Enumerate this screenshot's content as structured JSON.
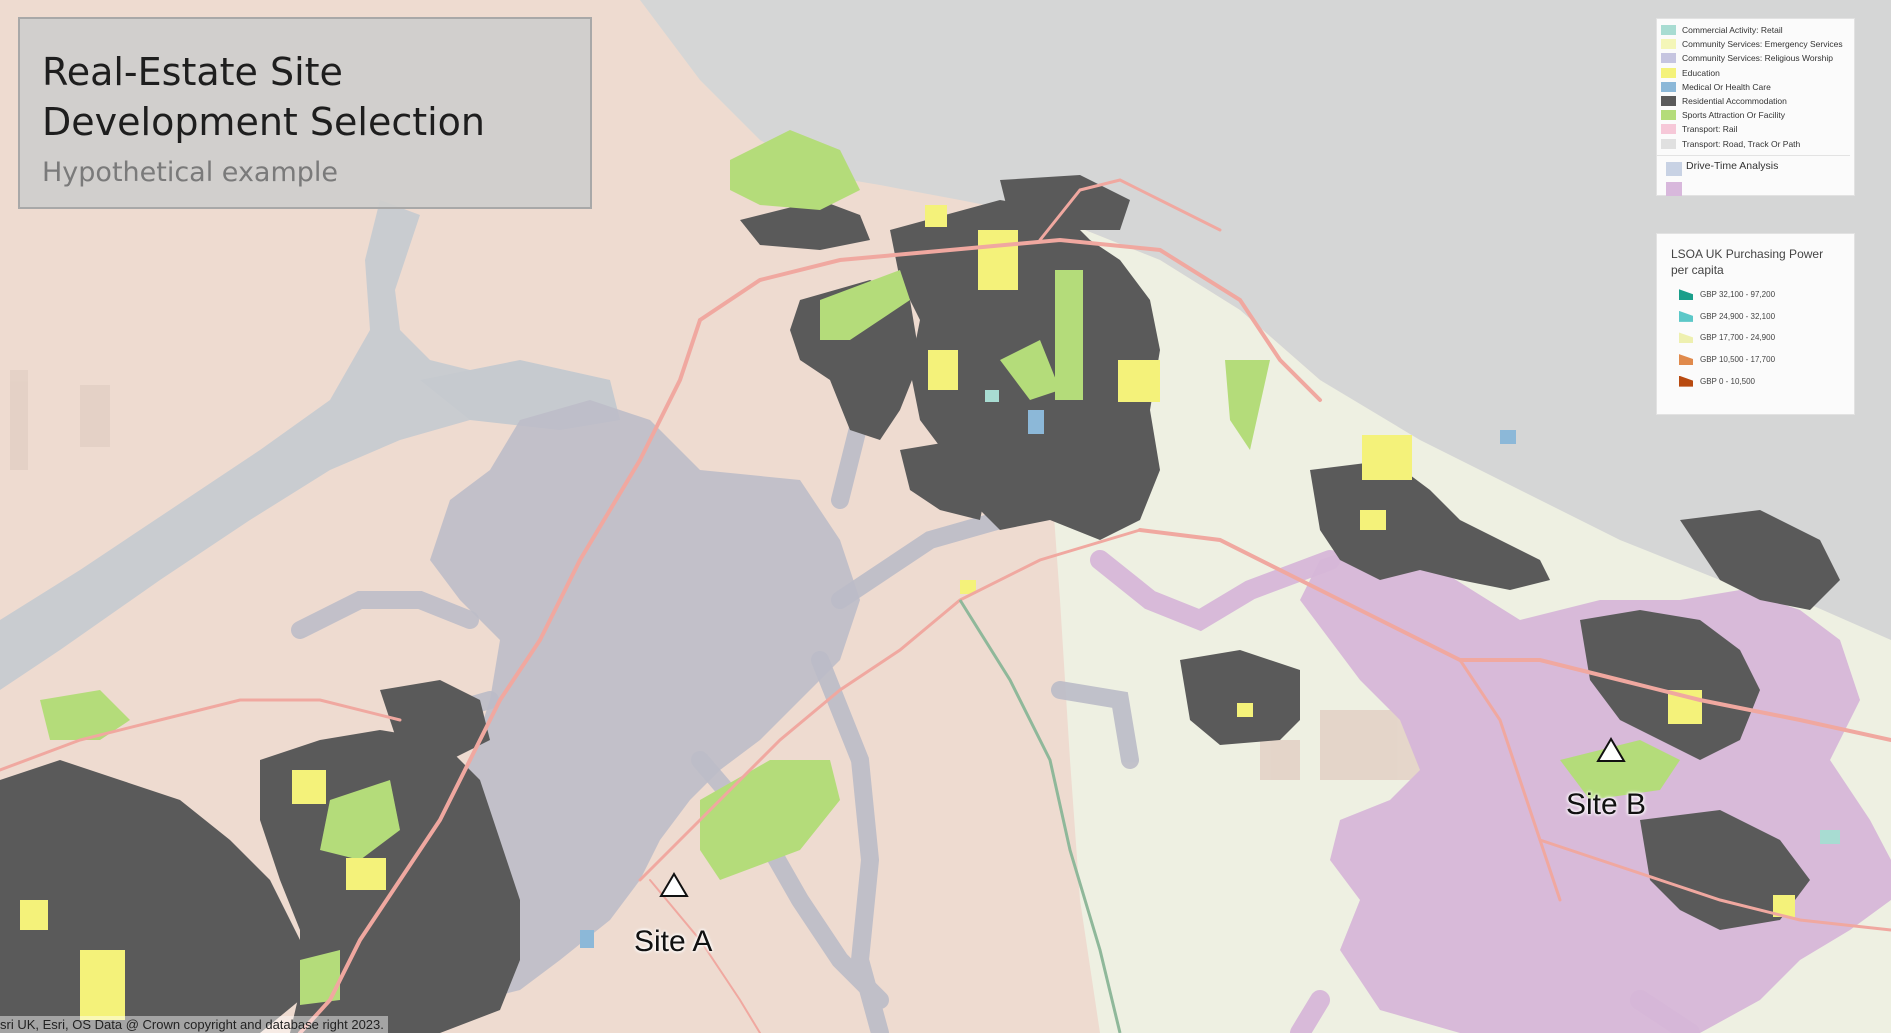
{
  "title": {
    "main": "Real-Estate Site Development Selection",
    "subtitle": "Hypothetical example"
  },
  "legend_landuse": {
    "items": [
      {
        "label": "Commercial Activity: Retail",
        "color": "#a8dcd2"
      },
      {
        "label": "Community Services: Emergency Services",
        "color": "#f4f6b8"
      },
      {
        "label": "Community Services: Religious Worship",
        "color": "#c6c5e0"
      },
      {
        "label": "Education",
        "color": "#f4f27a"
      },
      {
        "label": "Medical Or Health Care",
        "color": "#8cb8d8"
      },
      {
        "label": "Residential Accommodation",
        "color": "#5a5a5a"
      },
      {
        "label": "Sports Attraction Or Facility",
        "color": "#b4dc7a"
      },
      {
        "label": "Transport: Rail",
        "color": "#f6c8d8"
      },
      {
        "label": "Transport: Road, Track Or Path",
        "color": "#e0e0e0"
      }
    ],
    "drive_time": {
      "label": "Drive-Time Analysis",
      "colors": [
        "#c8d2e4",
        "#d8b8dc"
      ]
    }
  },
  "legend_power": {
    "title": "LSOA UK Purchasing Power per capita",
    "items": [
      {
        "label": "GBP 32,100 - 97,200",
        "color": "#1a9e8a"
      },
      {
        "label": "GBP 24,900 - 32,100",
        "color": "#5cc8c8"
      },
      {
        "label": "GBP 17,700 - 24,900",
        "color": "#eef0b0"
      },
      {
        "label": "GBP 10,500 - 17,700",
        "color": "#e08a4c"
      },
      {
        "label": "GBP 0 - 10,500",
        "color": "#b84a10"
      }
    ]
  },
  "sites": [
    {
      "label": "Site A"
    },
    {
      "label": "Site B"
    }
  ],
  "attribution": "sri UK, Esri, OS Data @ Crown copyright and database right 2023.",
  "colors": {
    "sea": "#d5d6d6",
    "land_west": "#eedbd0",
    "land_east": "#eef0e2",
    "drive_time_grey": "#bcbcc8",
    "drive_time_purple": "#d6b6d8",
    "residential": "#5a5a5a",
    "sports": "#b4dc7a",
    "education": "#f4f27a",
    "road": "#f0a8a0"
  }
}
